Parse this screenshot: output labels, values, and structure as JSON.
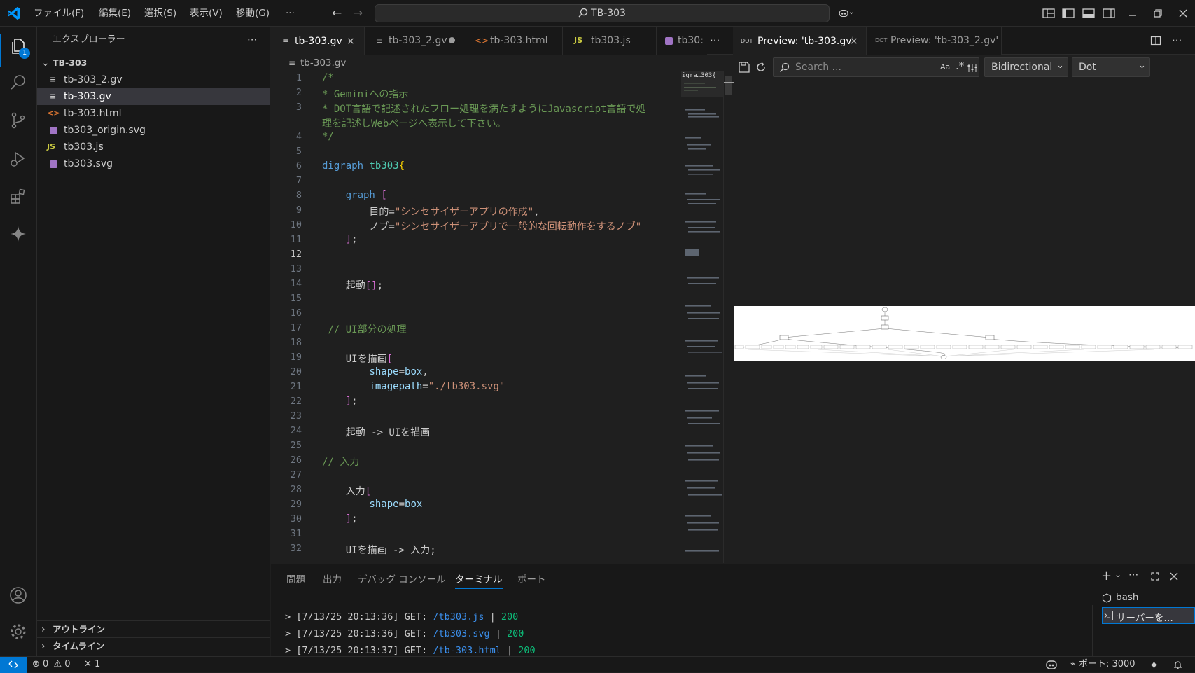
{
  "title_bar": {
    "menus": [
      "ファイル(F)",
      "編集(E)",
      "選択(S)",
      "表示(V)",
      "移動(G)",
      "···"
    ],
    "search_text": "TB-303"
  },
  "sidebar": {
    "header": "エクスプローラー",
    "folder": "TB-303",
    "files": [
      {
        "name": "tb-303_2.gv",
        "icon": "≡"
      },
      {
        "name": "tb-303.gv",
        "icon": "≡"
      },
      {
        "name": "tb-303.html",
        "icon": "<>"
      },
      {
        "name": "tb303_origin.svg",
        "icon": "svg"
      },
      {
        "name": "tb303.js",
        "icon": "JS"
      },
      {
        "name": "tb303.svg",
        "icon": "svg"
      }
    ],
    "outline": "アウトライン",
    "timeline": "タイムライン",
    "explorer_badge": "1"
  },
  "editor": {
    "tabs": [
      {
        "label": "tb-303.gv",
        "icon": "≡"
      },
      {
        "label": "tb-303_2.gv",
        "icon": "≡"
      },
      {
        "label": "tb-303.html",
        "icon": "<>"
      },
      {
        "label": "tb303.js",
        "icon": "JS"
      },
      {
        "label": "tb30:",
        "icon": "svg"
      }
    ],
    "breadcrumb": "tb-303.gv",
    "line_numbers": [
      "1",
      "2",
      "3",
      "",
      "4",
      "5",
      "6",
      "7",
      "8",
      "9",
      "10",
      "11",
      "12",
      "13",
      "14",
      "15",
      "16",
      "17",
      "18",
      "19",
      "20",
      "21",
      "22",
      "23",
      "24",
      "25",
      "26",
      "27",
      "28",
      "29",
      "30",
      "31",
      "32"
    ],
    "current_line": "12",
    "minimap_label": "igra…303{"
  },
  "preview": {
    "tabs": [
      "Preview: 'tb-303.gv'",
      "Preview: 'tb-303_2.gv'"
    ],
    "search_placeholder": "Search ...",
    "search_opt": "Aa",
    "direction": "Bidirectional",
    "engine": "Dot"
  },
  "panel": {
    "tabs": [
      "問題",
      "出力",
      "デバッグ コンソール",
      "ターミナル",
      "ポート"
    ],
    "active_tab": "ターミナル",
    "terminals": [
      "bash",
      "サーバーを…"
    ],
    "lines": [
      {
        "prefix": "> [7/13/25 20:13:36] GET: ",
        "path": "/tb303.js",
        "sep": " | ",
        "status": "200"
      },
      {
        "prefix": "> [7/13/25 20:13:36] GET: ",
        "path": "/tb303.svg",
        "sep": " | ",
        "status": "200"
      },
      {
        "prefix": "> [7/13/25 20:13:37] GET: ",
        "path": "/tb-303.html",
        "sep": " | ",
        "status": "200"
      }
    ]
  },
  "status_bar": {
    "errors": "0",
    "warnings": "0",
    "ports_count": "1",
    "ports_label": "ポート: 3000"
  },
  "colors": {
    "accent": "#0078d4",
    "remote": "#0078d4",
    "background": "#1f1f1f",
    "sidebar": "#181818"
  }
}
